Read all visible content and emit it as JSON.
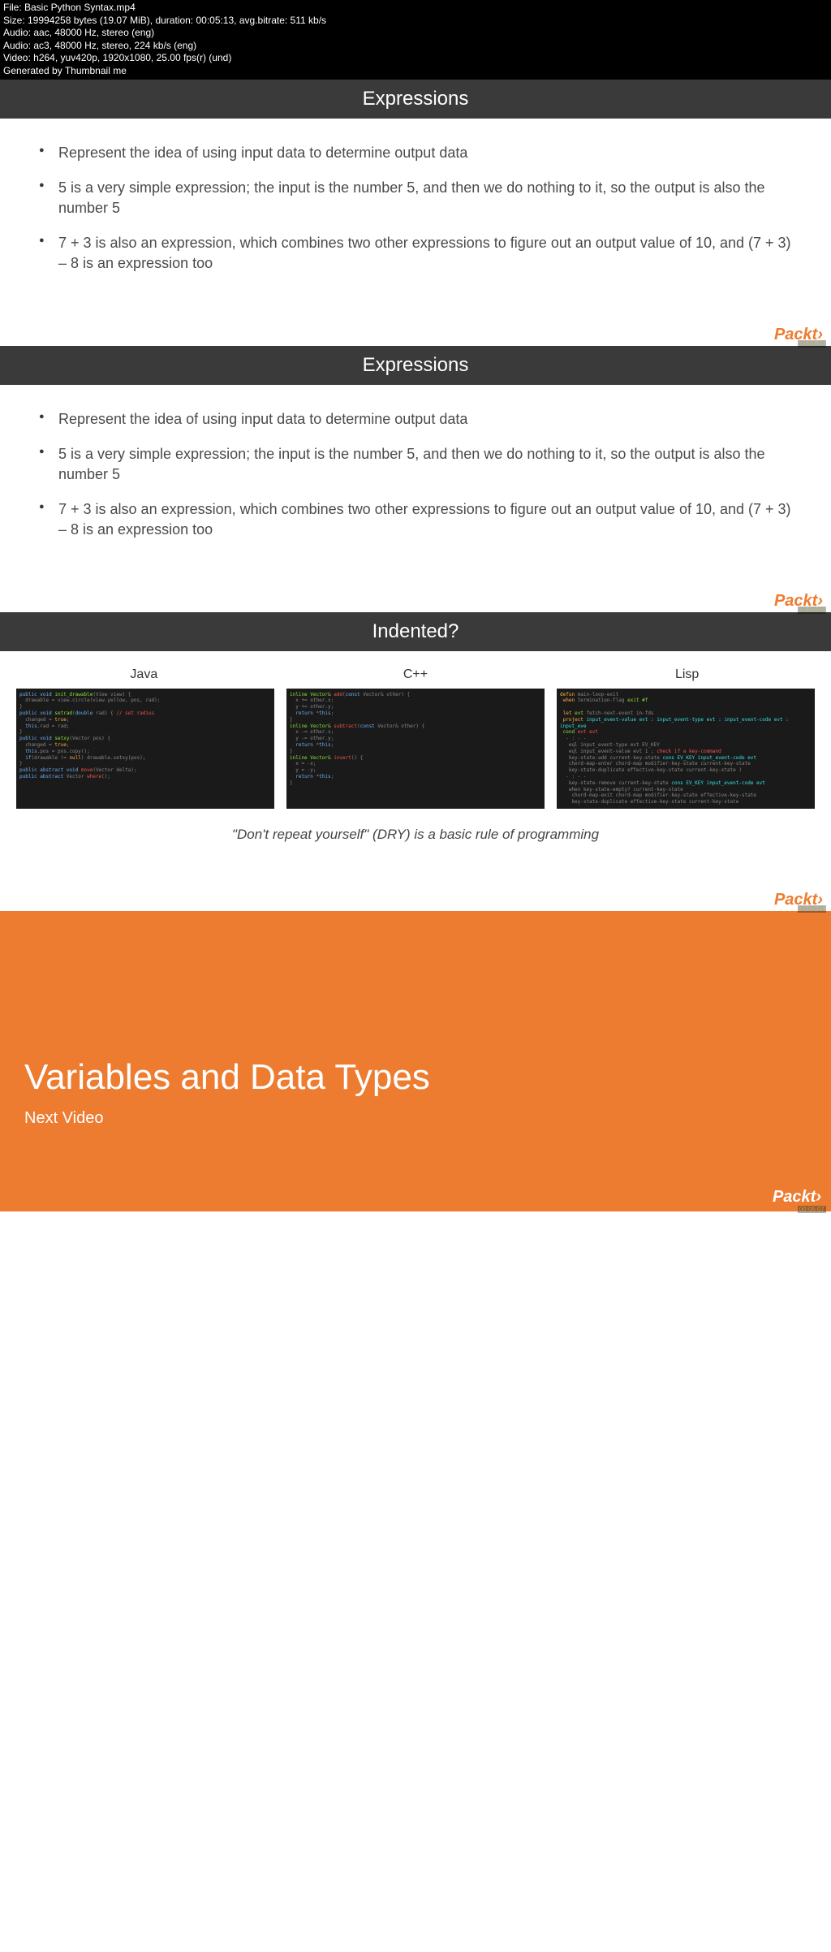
{
  "meta": {
    "file": "File: Basic Python Syntax.mp4",
    "size": "Size: 19994258 bytes (19.07 MiB), duration: 00:05:13, avg.bitrate: 511 kb/s",
    "audio1": "Audio: aac, 48000 Hz, stereo (eng)",
    "audio2": "Audio: ac3, 48000 Hz, stereo, 224 kb/s (eng)",
    "video": "Video: h264, yuv420p, 1920x1080, 25.00 fps(r) (und)",
    "gen": "Generated by Thumbnail me"
  },
  "slide1": {
    "title": "Expressions",
    "bullets": [
      "Represent the idea of using input data to determine output data",
      "5 is a very simple expression; the input is the number 5, and then we do nothing to it, so the output is also the number 5",
      "7 + 3 is also an expression, which combines two other expressions to figure out an output value of 10, and (7 + 3) – 8 is an expression too"
    ],
    "ts": "00:01:15"
  },
  "slide2": {
    "title": "Expressions",
    "bullets": [
      "Represent the idea of using input data to determine output data",
      "5 is a very simple expression; the input is the number 5, and then we do nothing to it, so the output is also the number 5",
      "7 + 3 is also an expression, which combines two other expressions to figure out an output value of 10, and (7 + 3) – 8 is an expression too"
    ],
    "ts": "00:02:05"
  },
  "slide3": {
    "title": "Indented?",
    "langs": [
      "Java",
      "C++",
      "Lisp"
    ],
    "dry": "\"Don't repeat yourself\" (DRY) is a basic rule of programming",
    "ts": "00:03:31"
  },
  "slide4": {
    "title": "Variables and Data Types",
    "subtitle": "Next Video",
    "ts": "00:05:07"
  },
  "brand": "Packt"
}
